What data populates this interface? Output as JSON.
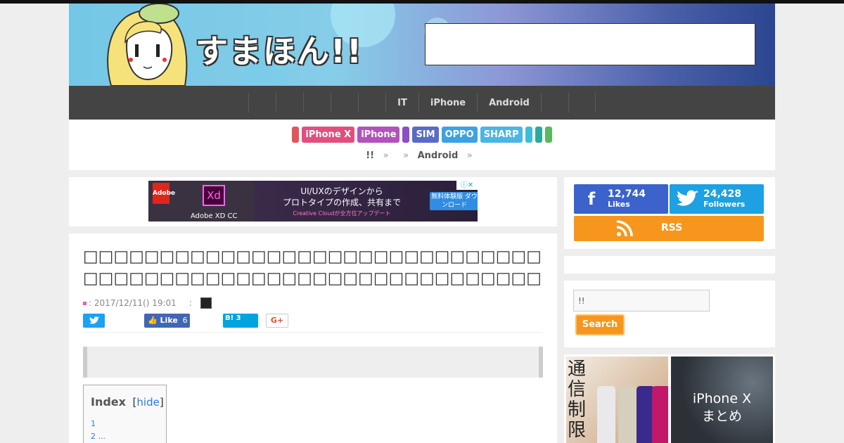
{
  "site": {
    "logo_text": "すまほん!!"
  },
  "nav": {
    "items": [
      "",
      "",
      "",
      "",
      "",
      "IT",
      "iPhone",
      "Android",
      "",
      ""
    ]
  },
  "tags": [
    {
      "label": "",
      "color": "#e5545a"
    },
    {
      "label": "iPhone X",
      "color": "#e24f7f"
    },
    {
      "label": "iPhone",
      "color": "#b252bd"
    },
    {
      "label": "",
      "color": "#8b4fc6"
    },
    {
      "label": "SIM",
      "color": "#5a6bc6"
    },
    {
      "label": "OPPO",
      "color": "#3ca2e3"
    },
    {
      "label": "SHARP",
      "color": "#4bb5e6"
    },
    {
      "label": "",
      "color": "#3cbdd8"
    },
    {
      "label": "",
      "color": "#2fa89c"
    },
    {
      "label": "",
      "color": "#5bb85c"
    }
  ],
  "breadcrumb": {
    "home": "!!",
    "sep": "»",
    "category": "Android"
  },
  "ad": {
    "adobe": "Adobe",
    "xd": "Xd",
    "caption": "Adobe XD CC",
    "line1": "UI/UXのデザインから",
    "line2": "プロトタイプの作成、共有まで",
    "line3": "Creative Cloudが全方位アップデート",
    "button": "無料体験版 ダウンロード",
    "close": "ⓘ✕"
  },
  "article": {
    "title": "□□□□□□□□□□□□□□□□□□□□□□□□□□□□□□□□□□□□□□□□□□□□□□□□□□□□□□□□□□□□",
    "date": ": 2017/12/11() 19:01",
    "author_sep": ":"
  },
  "share": {
    "fb_label": "Like",
    "fb_count": "6",
    "hb_label": "B!",
    "hb_count": "3",
    "gp_label": "G+"
  },
  "toc": {
    "title": "Index",
    "bracket_open": "[",
    "hide": "hide",
    "bracket_close": "]",
    "items": [
      "1",
      "2 ..."
    ]
  },
  "social": {
    "fb_count": "12,744",
    "fb_label": "Likes",
    "tw_count": "24,428",
    "tw_label": "Followers",
    "rss_label": "RSS"
  },
  "search": {
    "value": "!!",
    "button": "Search"
  },
  "banners": {
    "b1_text": "通信制限",
    "b2_line1": "iPhone X",
    "b2_line2": "まとめ"
  }
}
